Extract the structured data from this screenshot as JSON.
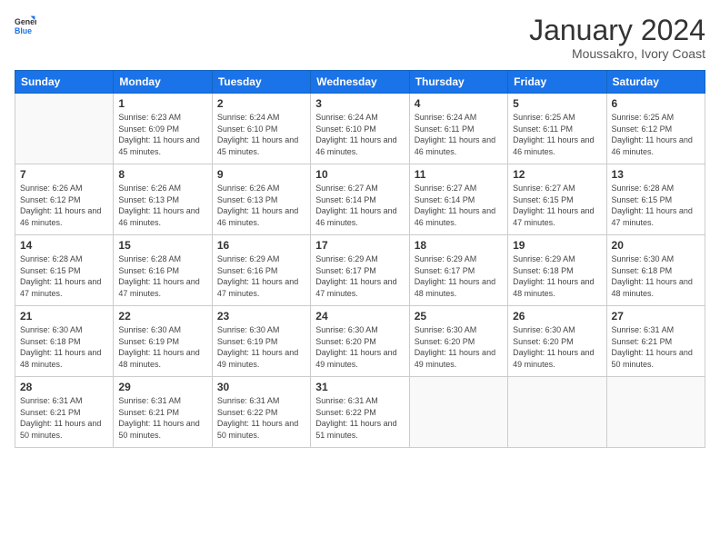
{
  "header": {
    "logo": {
      "general": "General",
      "blue": "Blue"
    },
    "month_title": "January 2024",
    "subtitle": "Moussakro, Ivory Coast"
  },
  "calendar": {
    "days_of_week": [
      "Sunday",
      "Monday",
      "Tuesday",
      "Wednesday",
      "Thursday",
      "Friday",
      "Saturday"
    ],
    "weeks": [
      [
        {
          "day": "",
          "info": ""
        },
        {
          "day": "1",
          "sunrise": "Sunrise: 6:23 AM",
          "sunset": "Sunset: 6:09 PM",
          "daylight": "Daylight: 11 hours and 45 minutes."
        },
        {
          "day": "2",
          "sunrise": "Sunrise: 6:24 AM",
          "sunset": "Sunset: 6:10 PM",
          "daylight": "Daylight: 11 hours and 45 minutes."
        },
        {
          "day": "3",
          "sunrise": "Sunrise: 6:24 AM",
          "sunset": "Sunset: 6:10 PM",
          "daylight": "Daylight: 11 hours and 46 minutes."
        },
        {
          "day": "4",
          "sunrise": "Sunrise: 6:24 AM",
          "sunset": "Sunset: 6:11 PM",
          "daylight": "Daylight: 11 hours and 46 minutes."
        },
        {
          "day": "5",
          "sunrise": "Sunrise: 6:25 AM",
          "sunset": "Sunset: 6:11 PM",
          "daylight": "Daylight: 11 hours and 46 minutes."
        },
        {
          "day": "6",
          "sunrise": "Sunrise: 6:25 AM",
          "sunset": "Sunset: 6:12 PM",
          "daylight": "Daylight: 11 hours and 46 minutes."
        }
      ],
      [
        {
          "day": "7",
          "sunrise": "Sunrise: 6:26 AM",
          "sunset": "Sunset: 6:12 PM",
          "daylight": "Daylight: 11 hours and 46 minutes."
        },
        {
          "day": "8",
          "sunrise": "Sunrise: 6:26 AM",
          "sunset": "Sunset: 6:13 PM",
          "daylight": "Daylight: 11 hours and 46 minutes."
        },
        {
          "day": "9",
          "sunrise": "Sunrise: 6:26 AM",
          "sunset": "Sunset: 6:13 PM",
          "daylight": "Daylight: 11 hours and 46 minutes."
        },
        {
          "day": "10",
          "sunrise": "Sunrise: 6:27 AM",
          "sunset": "Sunset: 6:14 PM",
          "daylight": "Daylight: 11 hours and 46 minutes."
        },
        {
          "day": "11",
          "sunrise": "Sunrise: 6:27 AM",
          "sunset": "Sunset: 6:14 PM",
          "daylight": "Daylight: 11 hours and 46 minutes."
        },
        {
          "day": "12",
          "sunrise": "Sunrise: 6:27 AM",
          "sunset": "Sunset: 6:15 PM",
          "daylight": "Daylight: 11 hours and 47 minutes."
        },
        {
          "day": "13",
          "sunrise": "Sunrise: 6:28 AM",
          "sunset": "Sunset: 6:15 PM",
          "daylight": "Daylight: 11 hours and 47 minutes."
        }
      ],
      [
        {
          "day": "14",
          "sunrise": "Sunrise: 6:28 AM",
          "sunset": "Sunset: 6:15 PM",
          "daylight": "Daylight: 11 hours and 47 minutes."
        },
        {
          "day": "15",
          "sunrise": "Sunrise: 6:28 AM",
          "sunset": "Sunset: 6:16 PM",
          "daylight": "Daylight: 11 hours and 47 minutes."
        },
        {
          "day": "16",
          "sunrise": "Sunrise: 6:29 AM",
          "sunset": "Sunset: 6:16 PM",
          "daylight": "Daylight: 11 hours and 47 minutes."
        },
        {
          "day": "17",
          "sunrise": "Sunrise: 6:29 AM",
          "sunset": "Sunset: 6:17 PM",
          "daylight": "Daylight: 11 hours and 47 minutes."
        },
        {
          "day": "18",
          "sunrise": "Sunrise: 6:29 AM",
          "sunset": "Sunset: 6:17 PM",
          "daylight": "Daylight: 11 hours and 48 minutes."
        },
        {
          "day": "19",
          "sunrise": "Sunrise: 6:29 AM",
          "sunset": "Sunset: 6:18 PM",
          "daylight": "Daylight: 11 hours and 48 minutes."
        },
        {
          "day": "20",
          "sunrise": "Sunrise: 6:30 AM",
          "sunset": "Sunset: 6:18 PM",
          "daylight": "Daylight: 11 hours and 48 minutes."
        }
      ],
      [
        {
          "day": "21",
          "sunrise": "Sunrise: 6:30 AM",
          "sunset": "Sunset: 6:18 PM",
          "daylight": "Daylight: 11 hours and 48 minutes."
        },
        {
          "day": "22",
          "sunrise": "Sunrise: 6:30 AM",
          "sunset": "Sunset: 6:19 PM",
          "daylight": "Daylight: 11 hours and 48 minutes."
        },
        {
          "day": "23",
          "sunrise": "Sunrise: 6:30 AM",
          "sunset": "Sunset: 6:19 PM",
          "daylight": "Daylight: 11 hours and 49 minutes."
        },
        {
          "day": "24",
          "sunrise": "Sunrise: 6:30 AM",
          "sunset": "Sunset: 6:20 PM",
          "daylight": "Daylight: 11 hours and 49 minutes."
        },
        {
          "day": "25",
          "sunrise": "Sunrise: 6:30 AM",
          "sunset": "Sunset: 6:20 PM",
          "daylight": "Daylight: 11 hours and 49 minutes."
        },
        {
          "day": "26",
          "sunrise": "Sunrise: 6:30 AM",
          "sunset": "Sunset: 6:20 PM",
          "daylight": "Daylight: 11 hours and 49 minutes."
        },
        {
          "day": "27",
          "sunrise": "Sunrise: 6:31 AM",
          "sunset": "Sunset: 6:21 PM",
          "daylight": "Daylight: 11 hours and 50 minutes."
        }
      ],
      [
        {
          "day": "28",
          "sunrise": "Sunrise: 6:31 AM",
          "sunset": "Sunset: 6:21 PM",
          "daylight": "Daylight: 11 hours and 50 minutes."
        },
        {
          "day": "29",
          "sunrise": "Sunrise: 6:31 AM",
          "sunset": "Sunset: 6:21 PM",
          "daylight": "Daylight: 11 hours and 50 minutes."
        },
        {
          "day": "30",
          "sunrise": "Sunrise: 6:31 AM",
          "sunset": "Sunset: 6:22 PM",
          "daylight": "Daylight: 11 hours and 50 minutes."
        },
        {
          "day": "31",
          "sunrise": "Sunrise: 6:31 AM",
          "sunset": "Sunset: 6:22 PM",
          "daylight": "Daylight: 11 hours and 51 minutes."
        },
        {
          "day": "",
          "info": ""
        },
        {
          "day": "",
          "info": ""
        },
        {
          "day": "",
          "info": ""
        }
      ]
    ]
  }
}
